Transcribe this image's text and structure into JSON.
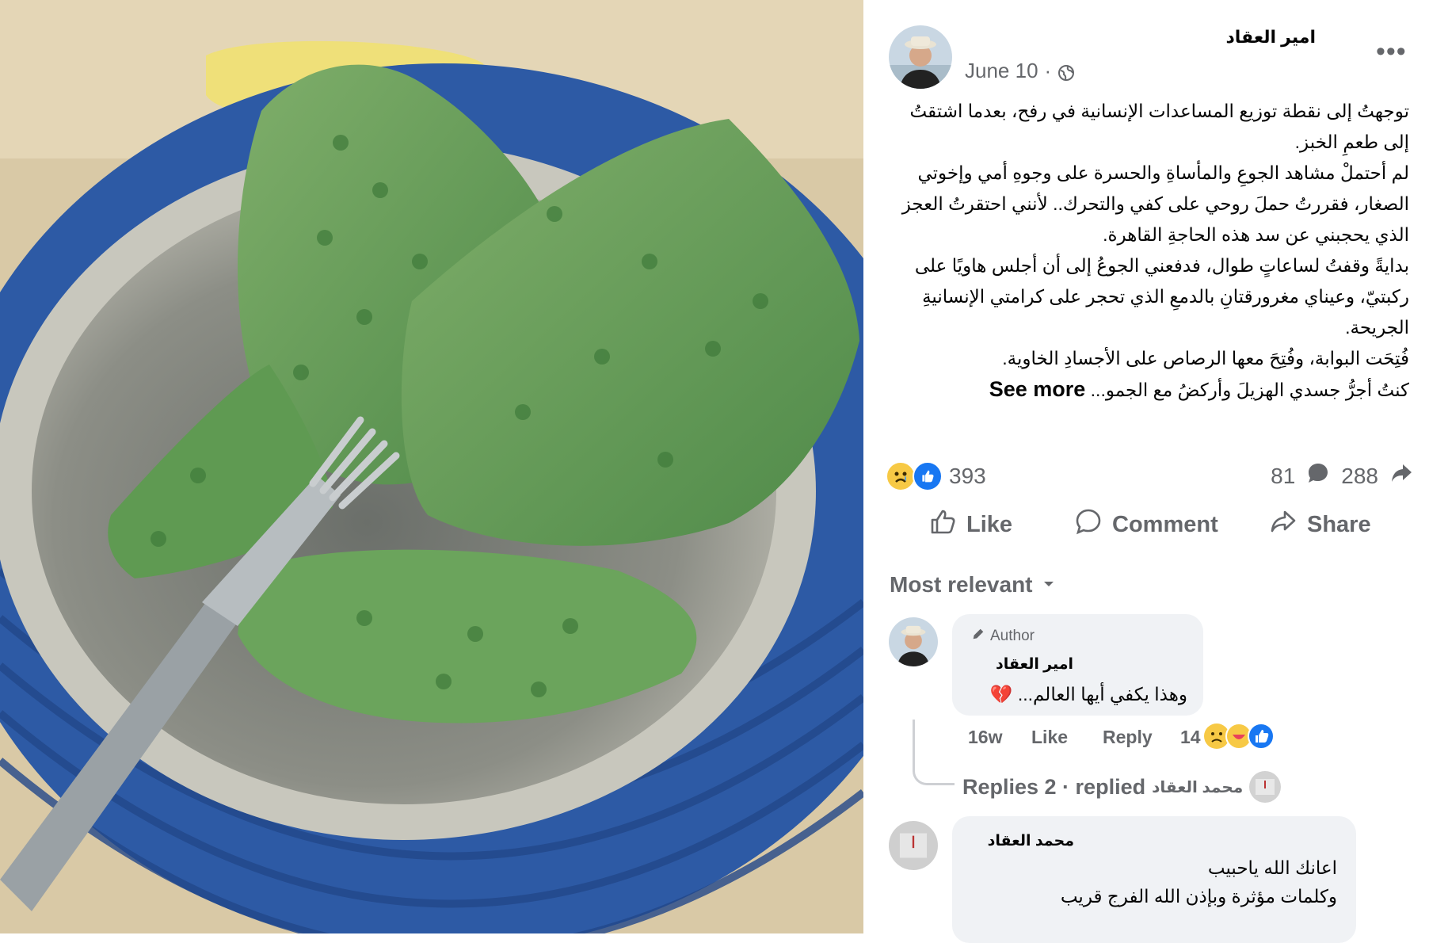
{
  "post": {
    "author": "امير العقاد",
    "date": "June 10",
    "date_sep": "·",
    "more_label": "•••",
    "paragraphs": [
      "توجهتُ إلى نقطة توزيع المساعدات الإنسانية في رفح، بعدما اشتقتُ إلى طعمِ الخبز.",
      "لم أحتملْ مشاهد الجوعِ والمأساةِ والحسرة على وجوهِ أمي وإخوتي الصغار، فقررتُ حملَ روحي على كفي والتحرك.. لأنني احتقرتُ العجز الذي يحجبني عن سد هذه الحاجةِ القاهرة.",
      "بدايةً وقفتُ لساعاتٍ طوال، فدفعني الجوعُ إلى أن أجلس هاويًا على ركبتيّ، وعيناي مغرورقتانِ بالدمعِ الذي تحجر على كرامتي الإنسانيةِ الجريحة.",
      "فُتِحَت البوابة، وفُتِحَ معها الرصاص على الأجسادِ الخاوية."
    ],
    "last_line": "كنتُ أجرُّ جسدي الهزيلَ وأركضُ مع الجمو...",
    "see_more": "See more"
  },
  "stats": {
    "reactions_count": "393",
    "comments_count": "81",
    "shares_count": "288"
  },
  "actions": {
    "like": "Like",
    "comment": "Comment",
    "share": "Share"
  },
  "sort_label": "Most relevant",
  "comments": [
    {
      "badge": "Author",
      "name": "امير العقاد",
      "text": "وهذا يكفي أيها العالم...",
      "emoji": "💔",
      "time": "16w",
      "like": "Like",
      "reply": "Reply",
      "reaction_count": "14",
      "replies_label": "Replies 2 · replied",
      "replied_by": "محمد العقاد"
    },
    {
      "name": "محمد العقاد",
      "line1": "اعانك الله ياحبيب",
      "line2": "وكلمات مؤثرة وبإذن الله الفرج قريب"
    }
  ]
}
